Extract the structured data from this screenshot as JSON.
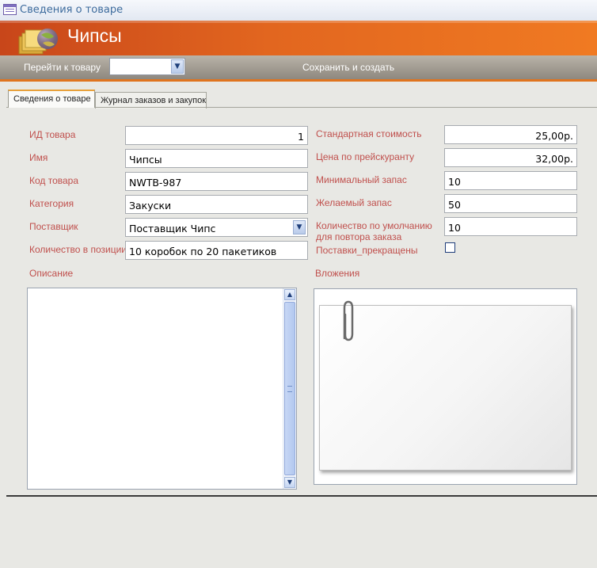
{
  "window": {
    "title": "Сведения о товаре",
    "icon": "form-icon"
  },
  "header": {
    "title": "Чипсы",
    "icon": "folders-icon",
    "accent_color": "#e2661f"
  },
  "toolbar": {
    "goto_label": "Перейти к товару",
    "goto_value": "",
    "save_label": "Сохранить и создать"
  },
  "tabs": [
    {
      "label": "Сведения о товаре",
      "active": true
    },
    {
      "label": "Журнал заказов и закупок",
      "active": false
    }
  ],
  "fields": {
    "product_id": {
      "label": "ИД товара",
      "value": "1"
    },
    "name": {
      "label": "Имя",
      "value": "Чипсы"
    },
    "product_code": {
      "label": "Код товара",
      "value": "NWTB-987"
    },
    "category": {
      "label": "Категория",
      "value": "Закуски"
    },
    "supplier": {
      "label": "Поставщик",
      "value": "Поставщик Чипс"
    },
    "quantity_per_unit": {
      "label": "Количество в позиции",
      "value": "10 коробок по 20 пакетиков"
    },
    "standard_cost": {
      "label": "Стандартная стоимость",
      "value": "25,00р."
    },
    "list_price": {
      "label": "Цена по прейскуранту",
      "value": "32,00р."
    },
    "reorder_level": {
      "label": "Минимальный запас",
      "value": "10"
    },
    "target_level": {
      "label": "Желаемый запас",
      "value": "50"
    },
    "min_reorder_qty": {
      "label_line1": "Количество по умолчанию",
      "label_line2": "для повтора заказа",
      "value": "10"
    },
    "discontinued": {
      "label": "Поставки_прекращены",
      "checked": false
    }
  },
  "description": {
    "label": "Описание",
    "value": ""
  },
  "attachments": {
    "label": "Вложения",
    "icon": "paperclip-icon"
  }
}
